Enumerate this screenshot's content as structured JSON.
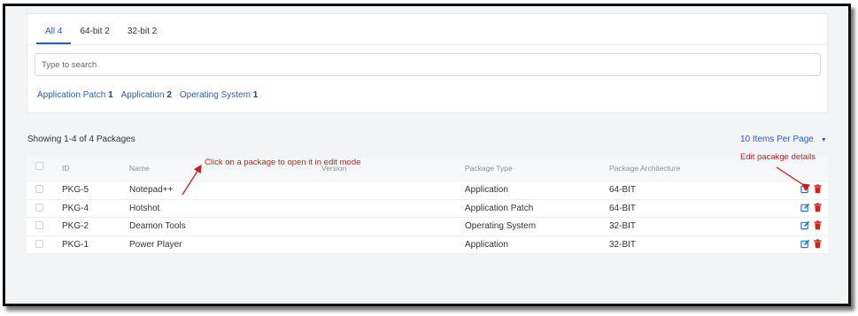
{
  "tabs": [
    {
      "label": "All",
      "count": "4"
    },
    {
      "label": "64-bit",
      "count": "2"
    },
    {
      "label": "32-bit",
      "count": "2"
    }
  ],
  "search": {
    "placeholder": "Type to search"
  },
  "filters": [
    {
      "label": "Application Patch",
      "count": "1"
    },
    {
      "label": "Application",
      "count": "2"
    },
    {
      "label": "Operating System",
      "count": "1"
    }
  ],
  "summary": {
    "showing": "Showing 1-4 of 4 Packages",
    "per_page": "10 Items Per Page"
  },
  "table": {
    "columns": [
      "ID",
      "Name",
      "Version",
      "Package Type",
      "Package Architecture"
    ],
    "rows": [
      {
        "id": "PKG-5",
        "name": "Notepad++",
        "version": "",
        "type": "Application",
        "arch": "64-BIT"
      },
      {
        "id": "PKG-4",
        "name": "Hotshot",
        "version": "",
        "type": "Application Patch",
        "arch": "64-BIT"
      },
      {
        "id": "PKG-2",
        "name": "Deamon Tools",
        "version": "",
        "type": "Operating System",
        "arch": "32-BIT"
      },
      {
        "id": "PKG-1",
        "name": "Power Player",
        "version": "",
        "type": "Application",
        "arch": "32-BIT"
      }
    ]
  },
  "annotations": {
    "click_package": "Click on a package to open it in edit mode",
    "edit_details": "Edit pacakge details"
  },
  "icons": {
    "edit": "edit-icon",
    "delete": "trash-icon"
  },
  "colors": {
    "accent": "#2a5cc7",
    "annotation": "#d11a1a",
    "delete": "#d62020",
    "edit": "#2a6fd6"
  }
}
